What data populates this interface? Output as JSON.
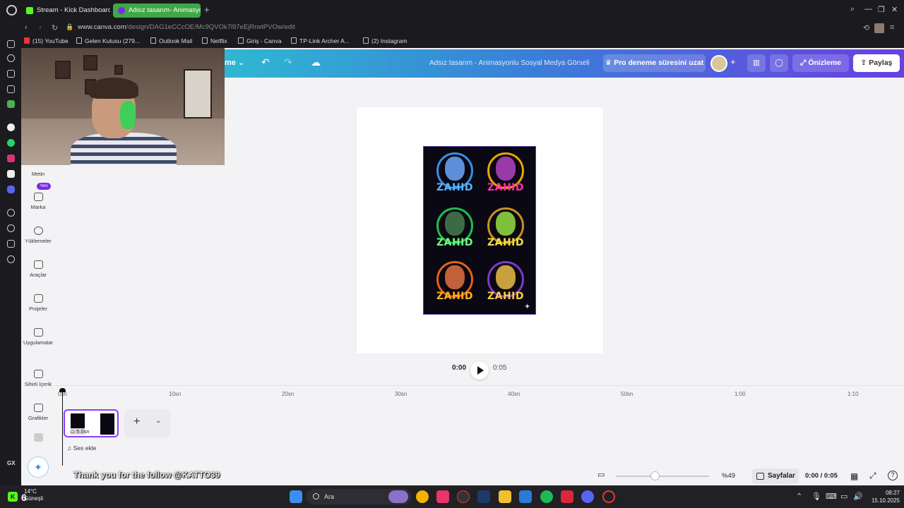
{
  "browser": {
    "tabs": [
      {
        "label": "Stream - Kick Dashboard"
      },
      {
        "label": "Adsız tasarım- Animasyonlu"
      }
    ],
    "url_host": "www.canva.com",
    "url_path": "/design/DAG1eCCcOE/Mc9QVOk7l97eEjRrwtPVOw/edit",
    "bookmarks": [
      {
        "label": "(15) YouTube"
      },
      {
        "label": "Gelen Kutusu (279..."
      },
      {
        "label": "Outlook Mail"
      },
      {
        "label": "Netflix"
      },
      {
        "label": "Giriş - Canva"
      },
      {
        "label": "TP-Link Archer A..."
      },
      {
        "label": "(2) Instagram"
      }
    ]
  },
  "canva": {
    "menu_label": "me",
    "title": "Adsız tasarım - Animasyonlu Sosyal Medya Görseli",
    "pro_button": "Pro deneme süresini uzat",
    "preview_button": "Önizleme",
    "share_button": "Paylaş",
    "sidebar": [
      {
        "label": "Metin"
      },
      {
        "label": "Marka"
      },
      {
        "label": "Yüklemeler"
      },
      {
        "label": "Araçlar"
      },
      {
        "label": "Projeler"
      },
      {
        "label": "Uygulamalar"
      },
      {
        "label": "Sihirli İçerik"
      },
      {
        "label": "Grafikler"
      }
    ],
    "new_badge": "Yeni",
    "design_name": "ZAHID",
    "playback": {
      "current": "0:00",
      "total": "0:05"
    },
    "timeline_ticks": [
      "0sn",
      "10sn",
      "20sn",
      "30sn",
      "40sn",
      "50sn",
      "1:00",
      "1:10"
    ],
    "clip_duration": "5.0sn",
    "add_audio": "Ses ekle",
    "zoom": "%49",
    "pages_button": "Sayfalar",
    "time_status": "0:00 / 0:05"
  },
  "overlay": {
    "follow_text": "Thank you for the follow @KATTO39",
    "gx_label": "GX",
    "kick_badge": "K",
    "badge_count": "6"
  },
  "taskbar": {
    "temp": "14°C",
    "weather": "Güneşli",
    "search_placeholder": "Ara",
    "time": "08:27",
    "date": "15.10.2025"
  },
  "colors": {
    "canva_gradient_start": "#2fb7d2",
    "canva_gradient_end": "#6a3fe0",
    "kick_green": "#53fc18",
    "canva_purple": "#8b3dff"
  }
}
